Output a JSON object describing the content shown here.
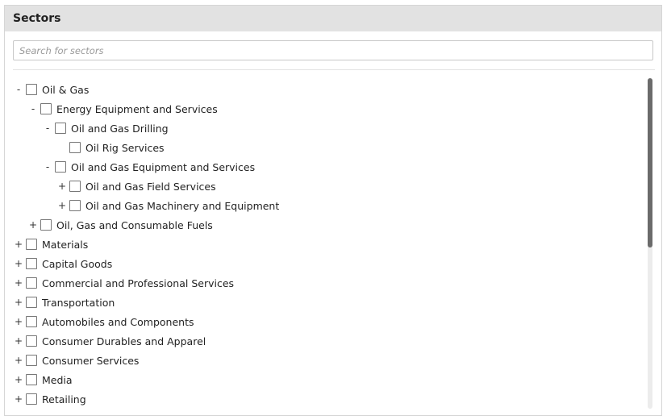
{
  "panel": {
    "title": "Sectors",
    "search_placeholder": "Search for sectors",
    "search_value": ""
  },
  "tree": [
    {
      "label": "Oil & Gas",
      "level": 0,
      "toggle": "-",
      "name": "oil-and-gas"
    },
    {
      "label": "Energy Equipment and Services",
      "level": 1,
      "toggle": "-",
      "name": "energy-equipment-and-services"
    },
    {
      "label": "Oil and Gas Drilling",
      "level": 2,
      "toggle": "-",
      "name": "oil-and-gas-drilling"
    },
    {
      "label": "Oil Rig Services",
      "level": 3,
      "toggle": "",
      "name": "oil-rig-services"
    },
    {
      "label": "Oil and Gas Equipment and Services",
      "level": 2,
      "toggle": "-",
      "name": "oil-and-gas-equipment-and-services"
    },
    {
      "label": "Oil and Gas Field Services",
      "level": 3,
      "toggle": "+",
      "name": "oil-and-gas-field-services"
    },
    {
      "label": "Oil and Gas Machinery and Equipment",
      "level": 3,
      "toggle": "+",
      "name": "oil-and-gas-machinery-and-equipment"
    },
    {
      "label": "Oil, Gas and Consumable Fuels",
      "level": 1,
      "toggle": "+",
      "name": "oil-gas-and-consumable-fuels"
    },
    {
      "label": "Materials",
      "level": 0,
      "toggle": "+",
      "name": "materials"
    },
    {
      "label": "Capital Goods",
      "level": 0,
      "toggle": "+",
      "name": "capital-goods"
    },
    {
      "label": "Commercial and Professional Services",
      "level": 0,
      "toggle": "+",
      "name": "commercial-and-professional-services"
    },
    {
      "label": "Transportation",
      "level": 0,
      "toggle": "+",
      "name": "transportation"
    },
    {
      "label": "Automobiles and Components",
      "level": 0,
      "toggle": "+",
      "name": "automobiles-and-components"
    },
    {
      "label": "Consumer Durables and Apparel",
      "level": 0,
      "toggle": "+",
      "name": "consumer-durables-and-apparel"
    },
    {
      "label": "Consumer Services",
      "level": 0,
      "toggle": "+",
      "name": "consumer-services"
    },
    {
      "label": "Media",
      "level": 0,
      "toggle": "+",
      "name": "media"
    },
    {
      "label": "Retailing",
      "level": 0,
      "toggle": "+",
      "name": "retailing"
    }
  ]
}
